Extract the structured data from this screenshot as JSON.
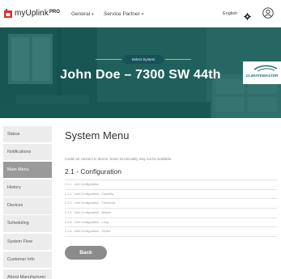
{
  "app": {
    "name": "myUplink",
    "badge": "PRO"
  },
  "nav": [
    {
      "label": "General",
      "has_dropdown": true
    },
    {
      "label": "Service Partner",
      "has_dropdown": true
    }
  ],
  "header": {
    "language": "English"
  },
  "hero": {
    "pill_label": "Select System",
    "title": "John Doe – 7300 SW 44th",
    "brand_logo": "CLIMATEMASTER"
  },
  "sidebar": {
    "items": [
      {
        "label": "Status",
        "active": false
      },
      {
        "label": "Notifications",
        "active": false
      },
      {
        "label": "Main Menu",
        "active": true
      },
      {
        "label": "History",
        "active": false
      },
      {
        "label": "Devices",
        "active": false
      },
      {
        "label": "Scheduling",
        "active": false
      },
      {
        "label": "System Flow",
        "active": false
      },
      {
        "label": "Customer Info",
        "active": false
      },
      {
        "label": "About Manufacturer",
        "active": false
      }
    ]
  },
  "main": {
    "title": "System Menu",
    "warning": "Could not connect to device. Some functionality may not be available.",
    "section_title": "2.1 - Configuration",
    "items": [
      "2.1.1 - Unit Configuration",
      "2.1.2 - Unit Configuration - Capacity",
      "2.1.3 - Unit Configuration - Threshold",
      "2.1.4 - Unit Configuration - Blower",
      "2.1.5 - Unit Configuration - Loop",
      "2.1.6 - Unit Configuration - Option"
    ],
    "back_label": "Back"
  },
  "colors": {
    "hero_overlay": "#0a5c58",
    "brand_red": "#d9312b",
    "active_sidebar": "#9a9a9a",
    "back_button": "#8b8b8b"
  },
  "icons": {
    "logo": "house-icon",
    "settings": "gear-icon",
    "account": "user-icon"
  }
}
